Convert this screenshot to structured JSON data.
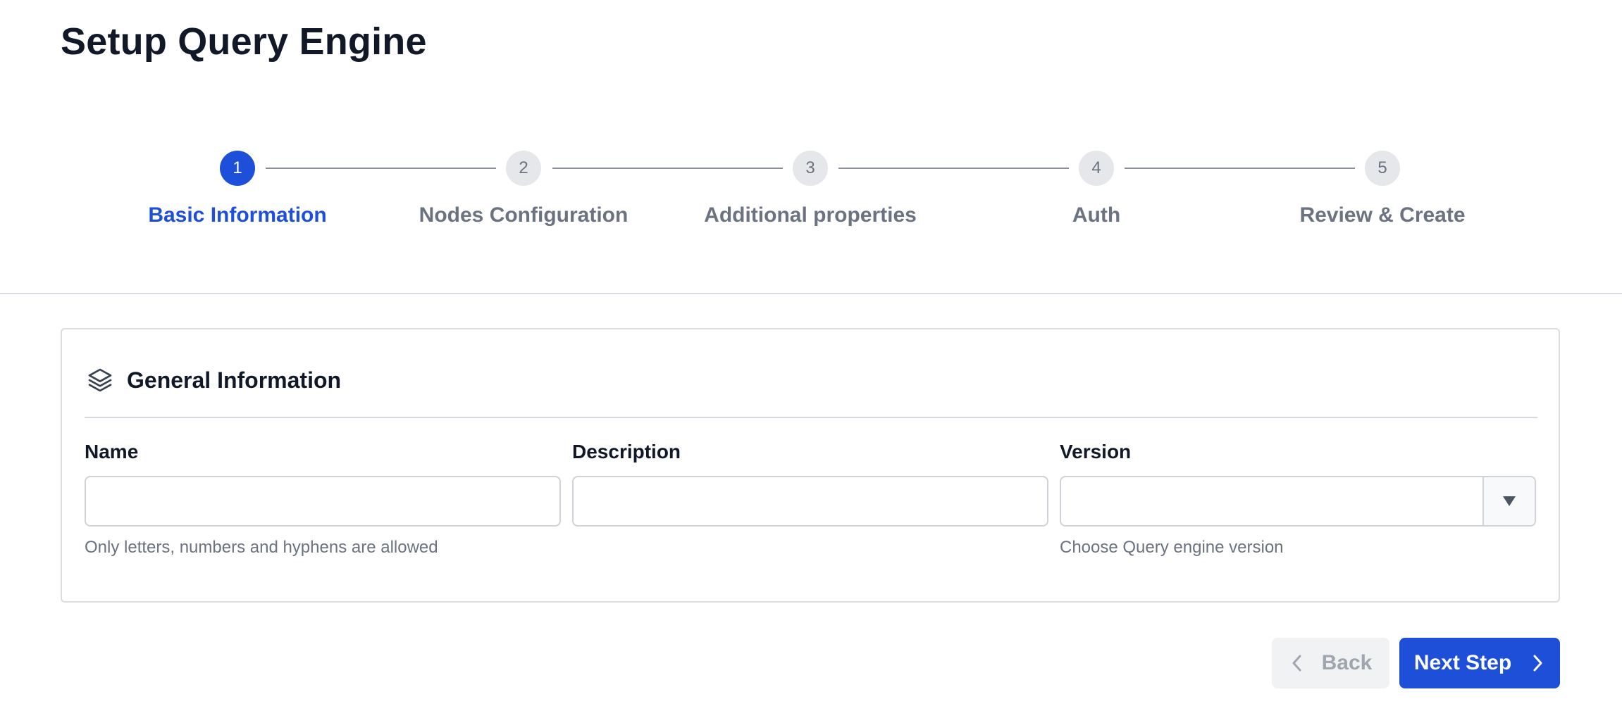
{
  "page": {
    "title": "Setup Query Engine"
  },
  "stepper": {
    "steps": [
      {
        "number": "1",
        "label": "Basic Information",
        "active": true
      },
      {
        "number": "2",
        "label": "Nodes Configuration",
        "active": false
      },
      {
        "number": "3",
        "label": "Additional properties",
        "active": false
      },
      {
        "number": "4",
        "label": "Auth",
        "active": false
      },
      {
        "number": "5",
        "label": "Review & Create",
        "active": false
      }
    ]
  },
  "card": {
    "icon": "layers-icon",
    "title": "General Information",
    "fields": {
      "name": {
        "label": "Name",
        "value": "",
        "placeholder": "",
        "help": "Only letters, numbers and hyphens are allowed"
      },
      "description": {
        "label": "Description",
        "value": "",
        "placeholder": ""
      },
      "version": {
        "label": "Version",
        "value": "",
        "help": "Choose Query engine version"
      }
    }
  },
  "actions": {
    "back_label": "Back",
    "next_label": "Next Step"
  },
  "colors": {
    "accent": "#1d4fd8",
    "muted": "#6b7280",
    "border": "#cfd3d9"
  }
}
